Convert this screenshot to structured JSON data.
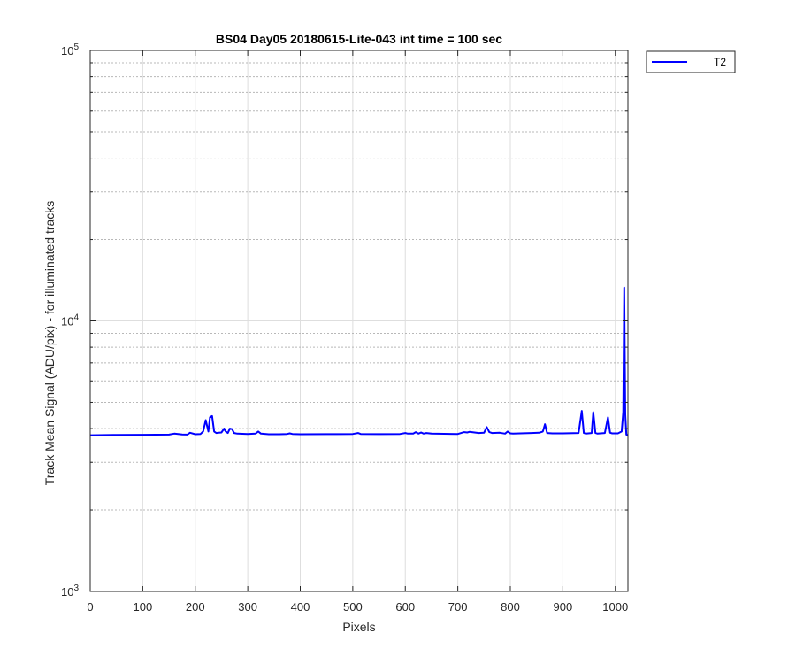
{
  "chart_data": {
    "type": "line",
    "title": "BS04 Day05 20180615-Lite-043 int time = 100 sec",
    "xlabel": "Pixels",
    "ylabel": "Track Mean Signal (ADU/pix) - for illuminated tracks",
    "xlim": [
      0,
      1024
    ],
    "ylim": [
      1000,
      100000
    ],
    "yscale": "log",
    "xticks": [
      0,
      100,
      200,
      300,
      400,
      500,
      600,
      700,
      800,
      900,
      1000
    ],
    "yticks": [
      {
        "value": 1000,
        "base": "10",
        "exponent": "3"
      },
      {
        "value": 10000,
        "base": "10",
        "exponent": "4"
      },
      {
        "value": 100000,
        "base": "10",
        "exponent": "5"
      }
    ],
    "grid": "on (major solid, minor dotted)",
    "legend_placement": "outside top-right",
    "series": [
      {
        "name": "T2",
        "color": "#0000ff",
        "x": [
          0,
          50,
          100,
          150,
          160,
          175,
          185,
          190,
          200,
          210,
          215,
          220,
          225,
          228,
          232,
          236,
          240,
          245,
          250,
          255,
          258,
          262,
          266,
          270,
          274,
          280,
          300,
          315,
          320,
          325,
          340,
          360,
          375,
          380,
          385,
          400,
          450,
          500,
          510,
          515,
          550,
          590,
          600,
          605,
          615,
          620,
          625,
          630,
          635,
          640,
          650,
          700,
          712,
          718,
          722,
          740,
          750,
          755,
          760,
          765,
          780,
          790,
          795,
          800,
          805,
          840,
          855,
          862,
          866,
          870,
          880,
          900,
          930,
          936,
          940,
          944,
          955,
          958,
          962,
          966,
          980,
          986,
          990,
          994,
          1005,
          1012,
          1015,
          1017,
          1019,
          1021,
          1024
        ],
        "y": [
          3780,
          3790,
          3795,
          3800,
          3830,
          3805,
          3800,
          3860,
          3810,
          3820,
          3900,
          4300,
          3900,
          4400,
          4450,
          3900,
          3850,
          3860,
          3870,
          4000,
          3900,
          3850,
          4000,
          3980,
          3850,
          3830,
          3820,
          3830,
          3900,
          3830,
          3810,
          3810,
          3820,
          3840,
          3820,
          3810,
          3815,
          3820,
          3850,
          3820,
          3815,
          3820,
          3850,
          3830,
          3830,
          3880,
          3830,
          3870,
          3830,
          3850,
          3830,
          3820,
          3880,
          3870,
          3890,
          3850,
          3860,
          4050,
          3880,
          3850,
          3860,
          3830,
          3900,
          3840,
          3830,
          3850,
          3860,
          3900,
          4150,
          3850,
          3840,
          3840,
          3850,
          4650,
          3850,
          3830,
          3850,
          4600,
          3850,
          3830,
          3850,
          4400,
          3860,
          3840,
          3840,
          3900,
          4600,
          13300,
          4500,
          3800,
          3780
        ]
      }
    ]
  }
}
